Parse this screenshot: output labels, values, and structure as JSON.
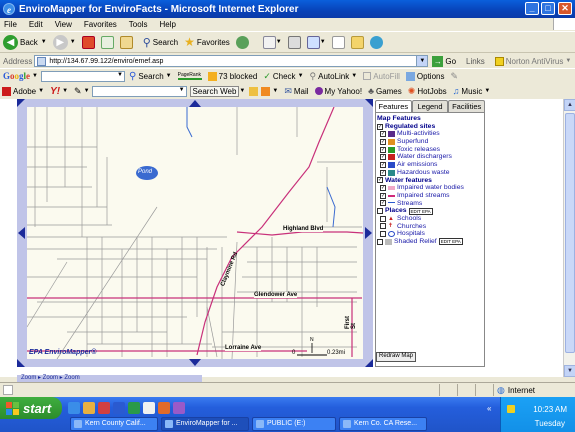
{
  "window": {
    "title": "EnviroMapper for EnviroFacts - Microsoft Internet Explorer",
    "min": "_",
    "max": "□",
    "close": "✕"
  },
  "menu": [
    "File",
    "Edit",
    "View",
    "Favorites",
    "Tools",
    "Help"
  ],
  "toolbar": {
    "back": "Back",
    "search": "Search",
    "favorites": "Favorites"
  },
  "address": {
    "label": "Address",
    "url": "http://134.67.99.122/enviro/emef.asp",
    "go": "Go",
    "links": "Links",
    "norton": "Norton AntiVirus"
  },
  "google_bar": {
    "logo": "Google",
    "search": "Search",
    "pagerank": "PageRank",
    "blocked": "73 blocked",
    "check": "Check",
    "autolink": "AutoLink",
    "autofill": "AutoFill",
    "options": "Options"
  },
  "yahoo_bar": {
    "adobe": "Adobe",
    "yahoo": "Y!",
    "search_web": "Search Web",
    "mail": "Mail",
    "my_yahoo": "My Yahoo!",
    "games": "Games",
    "hotjobs": "HotJobs",
    "music": "Music"
  },
  "map": {
    "labels": {
      "pond": "Pond",
      "highland": "Highland Blvd",
      "claymine": "Claymine Rd",
      "glendower": "Glendower Ave",
      "lorraine": "Lorraine Ave",
      "first_st": "First St"
    },
    "scale": {
      "zero": "0",
      "dist": "0.23mi",
      "north": "N"
    },
    "branding": "EPA EnviroMapper®"
  },
  "panel": {
    "tabs": [
      "Features",
      "Legend",
      "Facilities"
    ],
    "map_features": "Map Features",
    "regulated_sites": "Regulated sites",
    "regulated_items": [
      "Multi-activities",
      "Superfund",
      "Toxic releases",
      "Water dischargers",
      "Air emissions",
      "Hazardous waste"
    ],
    "water_features": "Water features",
    "water_items": [
      "Impaired water bodies",
      "Impaired streams",
      "Streams"
    ],
    "places": "Places",
    "place_items": [
      "Schools",
      "Churches",
      "Hospitals"
    ],
    "shaded_relief": "Shaded Relief",
    "edit_badge": "EDIT EPA",
    "redraw": "Redraw Map"
  },
  "bottom_strip": "Zoom ▸     Zoom ▸     Zoom",
  "status": {
    "zone": "Internet"
  },
  "taskbar": {
    "start": "start",
    "buttons": [
      "Kern County Calif...",
      "EnviroMapper for ...",
      "PUBLIC (E:)",
      "Kern Co. CA Rese..."
    ],
    "time": "10:23 AM",
    "day": "Tuesday"
  },
  "colors": {
    "titlebar": "#0a5fdc",
    "map_frame": "#c0c4e8",
    "road_pink": "#c8307a",
    "stream": "#3a6ad0",
    "link": "#1a1aa8"
  }
}
